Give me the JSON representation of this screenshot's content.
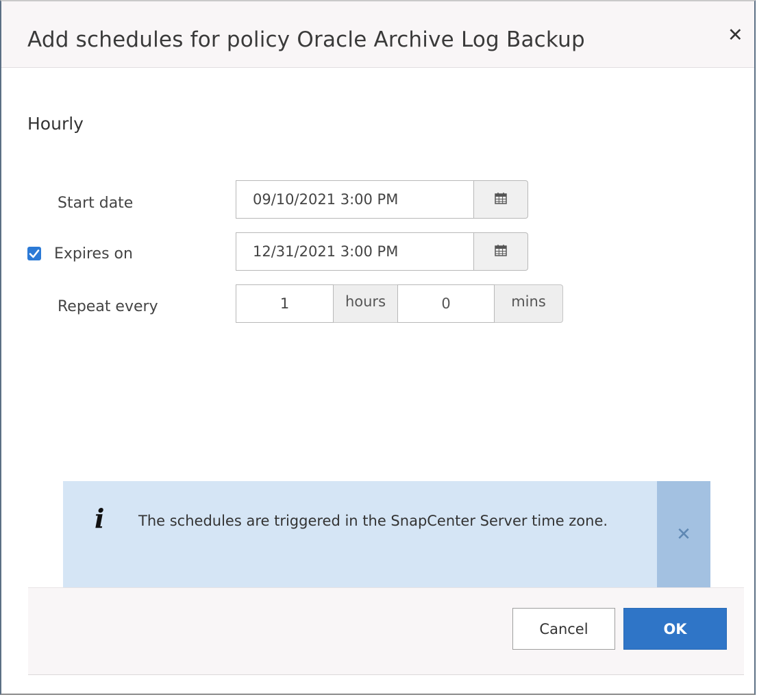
{
  "dialog": {
    "title": "Add schedules for policy Oracle Archive Log Backup",
    "close_icon": "close-icon"
  },
  "schedule": {
    "type_label": "Hourly",
    "start_date": {
      "label": "Start date",
      "value": "09/10/2021 3:00 PM",
      "icon": "calendar-icon"
    },
    "expires_on": {
      "label": "Expires on",
      "checked": true,
      "value": "12/31/2021 3:00 PM",
      "icon": "calendar-icon"
    },
    "repeat_every": {
      "label": "Repeat every",
      "hours_value": "1",
      "hours_unit": "hours",
      "mins_value": "0",
      "mins_unit": "mins"
    }
  },
  "info": {
    "icon": "info-icon",
    "text": "The schedules are triggered in the SnapCenter Server time zone.",
    "dismiss_icon": "close-icon"
  },
  "footer": {
    "cancel_label": "Cancel",
    "ok_label": "OK"
  },
  "colors": {
    "primary": "#2f75c7",
    "checkbox": "#2c7ad6",
    "info_background": "#d5e5f5",
    "info_dismiss_background": "#a3c1e1"
  }
}
